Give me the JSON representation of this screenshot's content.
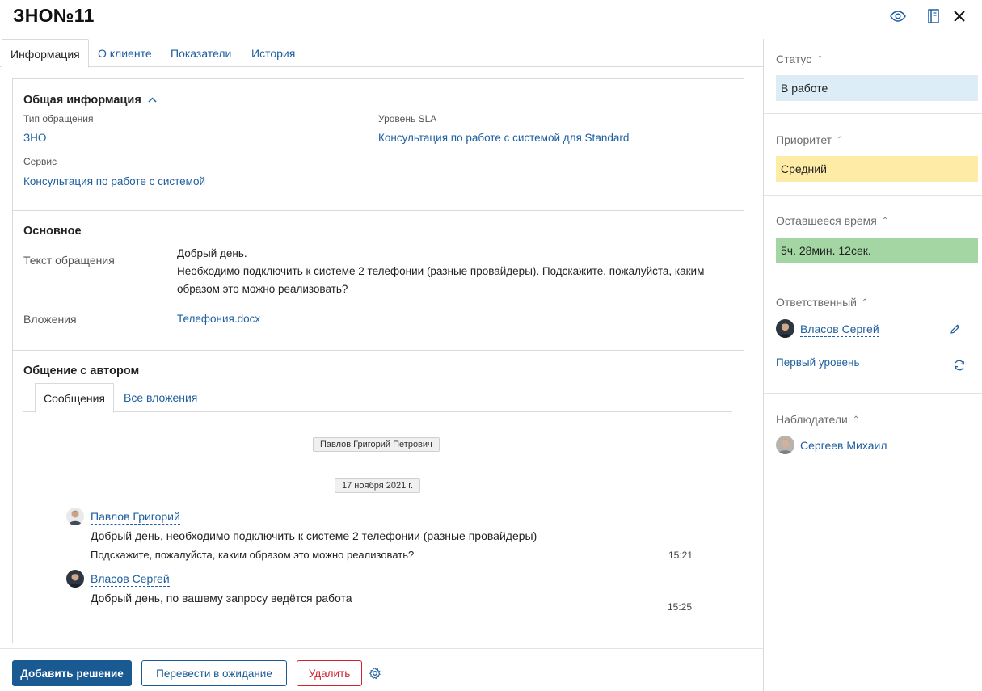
{
  "header": {
    "title": "ЗНО№11"
  },
  "tabs": [
    "Информация",
    "О клиенте",
    "Показатели",
    "История"
  ],
  "general": {
    "title": "Общая информация",
    "type_label": "Тип обращения",
    "type_value": "ЗНО",
    "sla_label": "Уровень SLA",
    "sla_value": "Консультация по работе с системой для Standard",
    "service_label": "Сервис",
    "service_value": "Консультация по работе с системой"
  },
  "main": {
    "title": "Основное",
    "text_label": "Текст обращения",
    "text_lines": [
      "Добрый день.",
      "Необходимо подключить к системе 2 телефонии (разные провайдеры). Подскажите, пожалуйста, каким",
      "образом это можно реализовать?"
    ],
    "attachments_label": "Вложения",
    "attachment": "Телефония.docx"
  },
  "chat": {
    "title": "Общение с автором",
    "tabs": [
      "Сообщения",
      "Все вложения"
    ],
    "participant_chip": "Павлов Григорий Петрович",
    "date_chip": "17 ноября 2021 г.",
    "messages": [
      {
        "author": "Павлов Григорий",
        "line1": "Добрый день, необходимо подключить к системе 2 телефонии (разные провайдеры)",
        "line2": "Подскажите, пожалуйста, каким образом это можно реализовать?",
        "time": "15:21"
      },
      {
        "author": "Власов Сергей",
        "line1": "Добрый день, по вашему запросу ведётся работа",
        "time": "15:25"
      }
    ]
  },
  "footer": {
    "add_solution": "Добавить решение",
    "to_waiting": "Перевести в ожидание",
    "delete": "Удалить"
  },
  "side": {
    "status_label": "Статус",
    "status_value": "В работе",
    "priority_label": "Приоритет",
    "priority_value": "Средний",
    "remaining_label": "Оставшееся время",
    "remaining_value": "5ч. 28мин. 12сек.",
    "responsible_label": "Ответственный",
    "responsible_person": "Власов Сергей",
    "responsible_level": "Первый уровень",
    "observers_label": "Наблюдатели",
    "observer_person": "Сергеев Михаил"
  },
  "colors": {
    "status_bg": "#dcedf7",
    "priority_bg": "#fdeba6",
    "remaining_bg": "#a4d6a4",
    "primary": "#1a5a93",
    "danger": "#d0232f",
    "link": "#1e5fa0"
  }
}
